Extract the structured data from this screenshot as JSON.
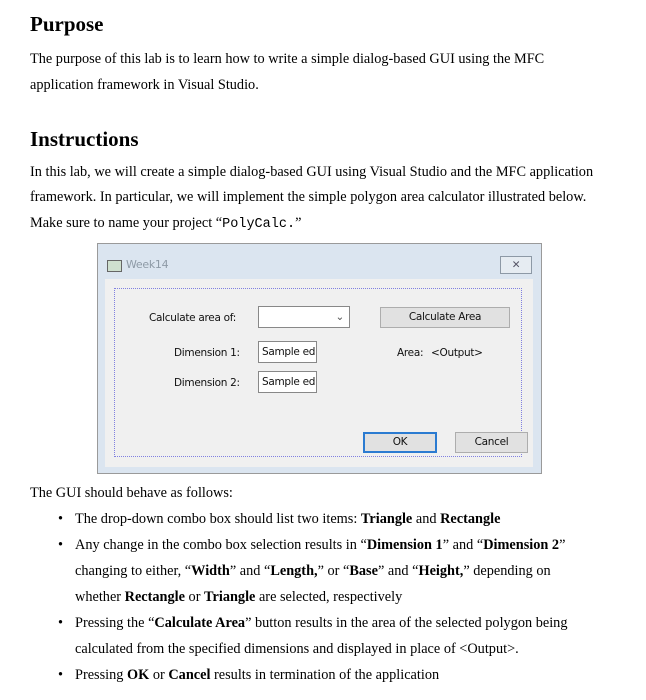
{
  "purpose": {
    "heading": "Purpose",
    "lines": [
      "The purpose of this lab is to learn how to write a simple dialog-based GUI using the MFC",
      "application framework in Visual Studio."
    ]
  },
  "instructions": {
    "heading": "Instructions",
    "lines": [
      "In this lab, we will create a simple dialog-based GUI using Visual Studio and the MFC application",
      "framework. In particular, we will implement the simple polygon area calculator illustrated below."
    ],
    "line3_pre": "Make sure to name your project “",
    "project": "PolyCalc.",
    "line3_post": "”"
  },
  "dialog": {
    "title": "Week14",
    "calc_label": "Calculate area of:",
    "combo_value": "",
    "calc_button": "Calculate Area",
    "dim1_label": "Dimension 1:",
    "dim1_value": "Sample edi",
    "dim2_label": "Dimension 2:",
    "dim2_value": "Sample edi",
    "area_label": "Area:",
    "area_output": "<Output>",
    "ok": "OK",
    "cancel": "Cancel",
    "close_icon": "close-icon"
  },
  "behavior": {
    "intro": "The GUI should behave as follows:",
    "bullets": [
      {
        "l1": [
          "The drop-down combo box should list two items: ",
          "Triangle",
          " and ",
          "Rectangle"
        ]
      },
      {
        "l1": [
          "Any change in the combo box selection results in “",
          "Dimension 1",
          "” and “",
          "Dimension 2",
          "”"
        ],
        "l2": [
          "changing to either, “",
          "Width",
          "” and “",
          "Length,",
          "” or “",
          "Base",
          "” and “",
          "Height,",
          "” depending on"
        ],
        "l3": [
          "whether ",
          "Rectangle",
          " or ",
          "Triangle",
          " are selected, respectively"
        ]
      },
      {
        "l1": [
          "Pressing the “",
          "Calculate Area",
          "” button results in the area of the selected polygon being"
        ],
        "l2": "calculated from the specified dimensions and displayed in place of <Output>."
      },
      {
        "l1": [
          "Pressing ",
          "OK",
          " or ",
          "Cancel",
          " results in termination of the application"
        ]
      }
    ]
  }
}
